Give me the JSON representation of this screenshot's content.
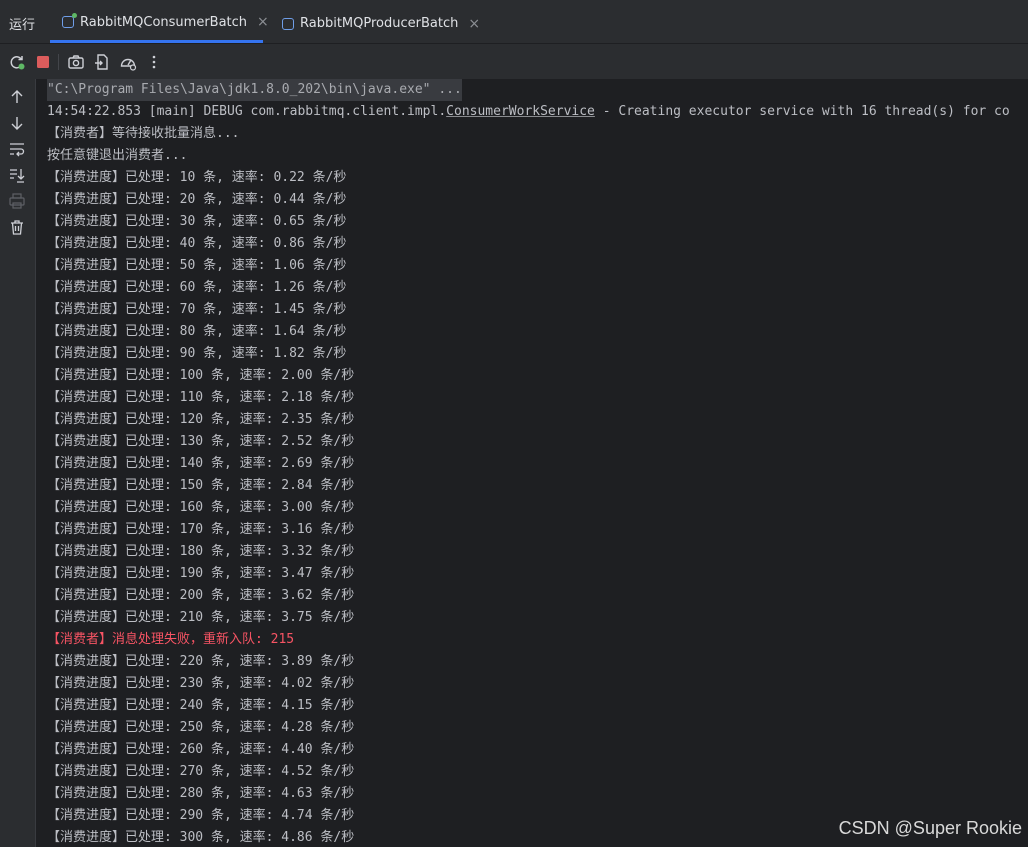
{
  "panel": {
    "title": "运行"
  },
  "tabs": [
    {
      "label": "RabbitMQConsumerBatch",
      "active": true,
      "icon": "java-class-running-icon"
    },
    {
      "label": "RabbitMQProducerBatch",
      "active": false,
      "icon": "java-class-icon"
    }
  ],
  "toolbar": {
    "icons": [
      "rerun-icon",
      "stop-icon",
      "camera-icon",
      "export-icon",
      "speedometer-icon",
      "more-vertical-icon"
    ]
  },
  "gutter": {
    "icons": [
      "arrow-up-icon",
      "arrow-down-icon",
      "soft-wrap-icon",
      "scroll-to-end-icon",
      "print-icon",
      "trash-icon"
    ]
  },
  "console": {
    "cmd": "\"C:\\Program Files\\Java\\jdk1.8.0_202\\bin\\java.exe\" ...",
    "debug": {
      "prefix": "14:54:22.853 [main] DEBUG com.rabbitmq.client.impl.",
      "cls": "ConsumerWorkService",
      "suffix": " - Creating executor service with 16 thread(s) for co"
    },
    "waiting": "【消费者】等待接收批量消息...",
    "press_key": "按任意键退出消费者...",
    "progress": [
      "【消费进度】已处理: 10 条, 速率: 0.22 条/秒",
      "【消费进度】已处理: 20 条, 速率: 0.44 条/秒",
      "【消费进度】已处理: 30 条, 速率: 0.65 条/秒",
      "【消费进度】已处理: 40 条, 速率: 0.86 条/秒",
      "【消费进度】已处理: 50 条, 速率: 1.06 条/秒",
      "【消费进度】已处理: 60 条, 速率: 1.26 条/秒",
      "【消费进度】已处理: 70 条, 速率: 1.45 条/秒",
      "【消费进度】已处理: 80 条, 速率: 1.64 条/秒",
      "【消费进度】已处理: 90 条, 速率: 1.82 条/秒",
      "【消费进度】已处理: 100 条, 速率: 2.00 条/秒",
      "【消费进度】已处理: 110 条, 速率: 2.18 条/秒",
      "【消费进度】已处理: 120 条, 速率: 2.35 条/秒",
      "【消费进度】已处理: 130 条, 速率: 2.52 条/秒",
      "【消费进度】已处理: 140 条, 速率: 2.69 条/秒",
      "【消费进度】已处理: 150 条, 速率: 2.84 条/秒",
      "【消费进度】已处理: 160 条, 速率: 3.00 条/秒",
      "【消费进度】已处理: 170 条, 速率: 3.16 条/秒",
      "【消费进度】已处理: 180 条, 速率: 3.32 条/秒",
      "【消费进度】已处理: 190 条, 速率: 3.47 条/秒",
      "【消费进度】已处理: 200 条, 速率: 3.62 条/秒",
      "【消费进度】已处理: 210 条, 速率: 3.75 条/秒"
    ],
    "error": "【消费者】消息处理失败，重新入队: 215",
    "progress_after": [
      "【消费进度】已处理: 220 条, 速率: 3.89 条/秒",
      "【消费进度】已处理: 230 条, 速率: 4.02 条/秒",
      "【消费进度】已处理: 240 条, 速率: 4.15 条/秒",
      "【消费进度】已处理: 250 条, 速率: 4.28 条/秒",
      "【消费进度】已处理: 260 条, 速率: 4.40 条/秒",
      "【消费进度】已处理: 270 条, 速率: 4.52 条/秒",
      "【消费进度】已处理: 280 条, 速率: 4.63 条/秒",
      "【消费进度】已处理: 290 条, 速率: 4.74 条/秒",
      "【消费进度】已处理: 300 条, 速率: 4.86 条/秒"
    ]
  },
  "watermark": "CSDN @Super Rookie",
  "colors": {
    "accent": "#3574f0",
    "error": "#f75464",
    "running": "#5fb865",
    "stop": "#db5c5c"
  }
}
